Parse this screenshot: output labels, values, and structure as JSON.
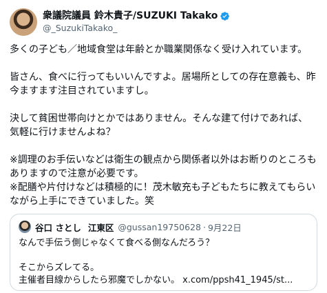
{
  "author": {
    "display_name": "衆議院議員 鈴木貴子/SUZUKI Takako",
    "handle": "@_SuzukiTakako_",
    "verified_icon": "verified-badge-icon",
    "verified_color": "#1d9bf0"
  },
  "tweet": {
    "paragraphs": [
      "多くの子ども／地域食堂は年齢とか職業関係なく受け入れています。",
      "皆さん、食べに行ってもいいんですよ。居場所としての存在意義も、昨今ますます注目されていますし。",
      "決して貧困世帯向けとかではありません。そんな建て付けであれば、気軽に行けませんよね？",
      "※調理のお手伝いなどは衛生の観点から関係者以外はお断りのところもありますので注意が必要です。",
      "※配膳や片付けなどは積極的に！茂木敏充も子どもたちに教えてもらいながら上手にできていました。笑"
    ]
  },
  "quote": {
    "name": "谷口 さとし",
    "district": "江東区",
    "handle": "@gussan19750628",
    "dot": "·",
    "date": "9月22日",
    "line1": "なんで手伝う側じゃなくて食べる側なんだろう？",
    "line2": "そこからズレてる。",
    "line3": "主催者目線からしたら邪魔でしかない。 x.com/ppsh41_1945/st..."
  }
}
